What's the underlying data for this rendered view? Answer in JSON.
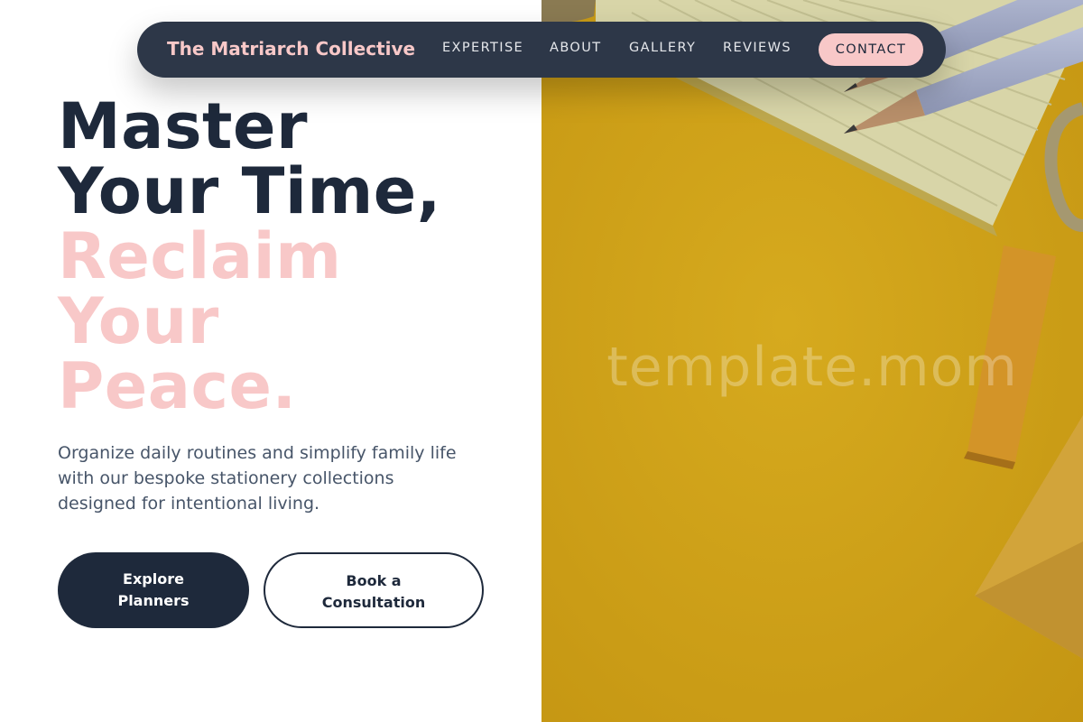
{
  "nav": {
    "brand": "The Matriarch Collective",
    "links": [
      "EXPERTISE",
      "ABOUT",
      "GALLERY",
      "REVIEWS"
    ],
    "contact": "CONTACT"
  },
  "hero": {
    "headline_dark": [
      "Master",
      "Your Time,"
    ],
    "headline_pink": [
      "Reclaim",
      "Your",
      "Peace."
    ],
    "subtitle": "Organize daily routines and simplify family life with our bespoke stationery collections designed for intentional living.",
    "primary_button": "Explore Planners",
    "secondary_button": "Book a Consultation"
  },
  "image": {
    "watermark": "template.mom"
  },
  "colors": {
    "navy": "#1e293b",
    "nav_bg": "#2d3748",
    "pink": "#f8c8c8",
    "mustard": "#cf9f16"
  }
}
